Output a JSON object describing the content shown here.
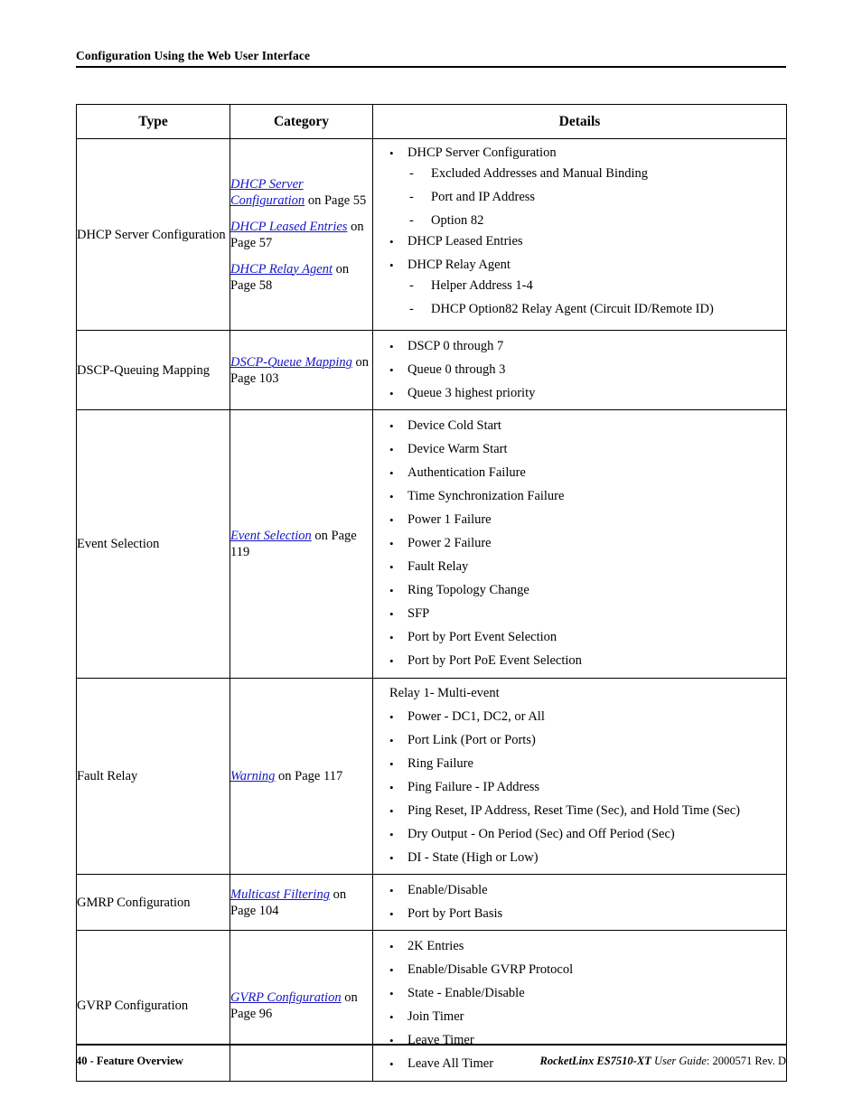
{
  "header": {
    "title": "Configuration Using the Web User Interface"
  },
  "table": {
    "columns": [
      "Type",
      "Category",
      "Details"
    ],
    "rows": [
      {
        "type": "DHCP Server Configuration",
        "category": [
          {
            "link": "DHCP Server Configuration",
            "tail": " on Page 55"
          },
          {
            "link": "DHCP Leased Entries",
            "tail": " on Page 57"
          },
          {
            "link": "DHCP Relay Agent",
            "tail": " on Page 58"
          }
        ],
        "details": [
          {
            "text": "DHCP Server Configuration",
            "subs": [
              "Excluded Addresses and Manual Binding",
              "Port and IP Address",
              "Option 82"
            ]
          },
          {
            "text": "DHCP Leased Entries"
          },
          {
            "text": "DHCP Relay Agent",
            "subs": [
              "Helper Address 1-4",
              "DHCP Option82 Relay Agent (Circuit ID/Remote ID)"
            ]
          }
        ]
      },
      {
        "type": "DSCP-Queuing Mapping",
        "category": [
          {
            "link": "DSCP-Queue Mapping",
            "tail": " on Page 103"
          }
        ],
        "details": [
          {
            "text": "DSCP 0 through 7"
          },
          {
            "text": "Queue 0 through 3"
          },
          {
            "text": "Queue 3 highest priority"
          }
        ]
      },
      {
        "type": "Event Selection",
        "category": [
          {
            "link": "Event Selection",
            "tail": " on Page 119"
          }
        ],
        "details": [
          {
            "text": "Device Cold Start"
          },
          {
            "text": "Device Warm Start"
          },
          {
            "text": "Authentication Failure"
          },
          {
            "text": "Time Synchronization Failure"
          },
          {
            "text": "Power 1 Failure"
          },
          {
            "text": "Power 2 Failure"
          },
          {
            "text": "Fault Relay"
          },
          {
            "text": "Ring Topology Change"
          },
          {
            "text": "SFP"
          },
          {
            "text": "Port by Port Event Selection"
          },
          {
            "text": "Port by Port PoE Event Selection"
          }
        ]
      },
      {
        "type": "Fault Relay",
        "category": [
          {
            "link": "Warning",
            "tail": " on Page 117"
          }
        ],
        "intro": "Relay 1- Multi-event",
        "details": [
          {
            "text": "Power - DC1, DC2, or All"
          },
          {
            "text": "Port Link (Port or Ports)"
          },
          {
            "text": "Ring Failure"
          },
          {
            "text": "Ping Failure - IP Address"
          },
          {
            "text": "Ping Reset, IP Address, Reset Time (Sec), and Hold Time (Sec)"
          },
          {
            "text": "Dry Output - On Period (Sec) and Off Period (Sec)"
          },
          {
            "text": "DI - State (High or Low)"
          }
        ]
      },
      {
        "type": "GMRP Configuration",
        "category": [
          {
            "link": "Multicast Filtering",
            "tail": " on Page 104"
          }
        ],
        "details": [
          {
            "text": "Enable/Disable"
          },
          {
            "text": "Port by Port Basis"
          }
        ]
      },
      {
        "type": "GVRP Configuration",
        "category": [
          {
            "link": "GVRP Configuration",
            "tail": " on Page 96"
          }
        ],
        "details": [
          {
            "text": "2K Entries"
          },
          {
            "text": "Enable/Disable GVRP Protocol"
          },
          {
            "text": "State - Enable/Disable"
          },
          {
            "text": "Join Timer"
          },
          {
            "text": "Leave Timer"
          },
          {
            "text": "Leave All Timer"
          }
        ]
      }
    ]
  },
  "footer": {
    "left": "40 - Feature Overview",
    "product": "RocketLinx ES7510-XT",
    "guide": " User Guide",
    "doc": ": 2000571 Rev. D"
  },
  "glyphs": {
    "bullet": "•",
    "dash": "-"
  },
  "colors": {
    "link": "#1414c8",
    "text": "#000000",
    "rule": "#000000"
  }
}
